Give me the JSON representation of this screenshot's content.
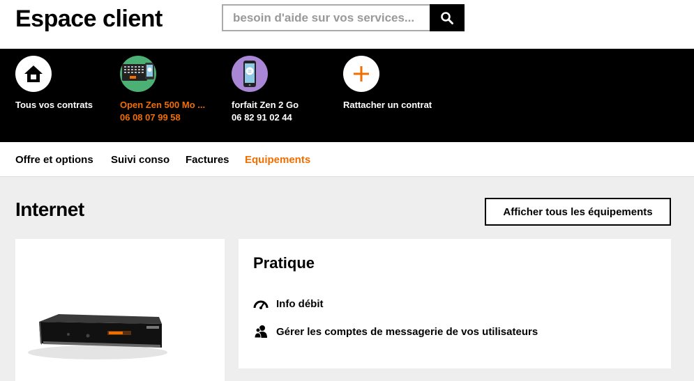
{
  "header": {
    "title": "Espace client",
    "search_placeholder": "besoin d'aide sur vos services..."
  },
  "contracts": [
    {
      "label": "Tous vos contrats",
      "number": "",
      "icon": "home-icon"
    },
    {
      "label": "Open Zen 500 Mo ...",
      "number": "06 08 07 99 58",
      "icon": "laptop-phone-icon",
      "active": true
    },
    {
      "label": "forfait Zen 2 Go",
      "number": "06 82 91 02 44",
      "icon": "mobile-phone-icon"
    },
    {
      "label": "Rattacher un contrat",
      "number": "",
      "icon": "plus-icon"
    }
  ],
  "nav": {
    "items": [
      "Offre et options",
      "Suivi conso",
      "Factures",
      "Equipements"
    ],
    "active": "Equipements"
  },
  "main": {
    "section_title": "Internet",
    "show_all_label": "Afficher tous les équipements",
    "pratique": {
      "title": "Pratique",
      "links": [
        {
          "label": "Info débit",
          "icon": "speedometer-icon"
        },
        {
          "label": "Gérer les comptes de messagerie de vos utilisateurs",
          "icon": "users-icon"
        }
      ]
    }
  },
  "colors": {
    "accent": "#f16e00",
    "contracts_bg": "#000000",
    "page_bg": "#eeeeee"
  }
}
